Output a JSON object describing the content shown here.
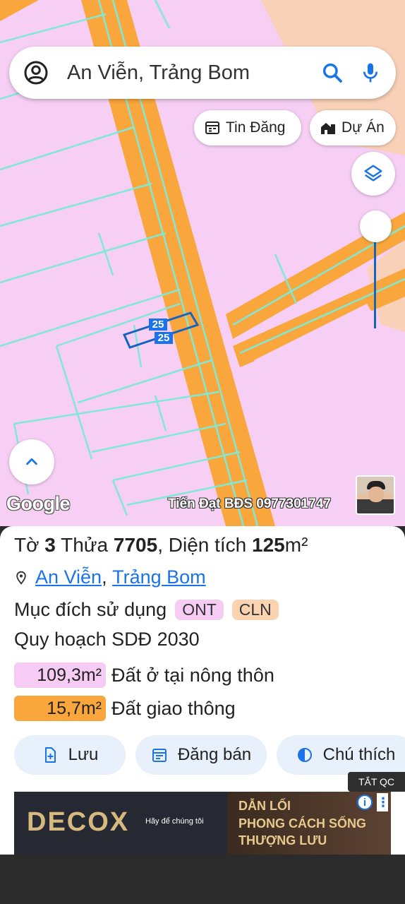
{
  "search": {
    "query": "An Viễn, Trảng Bom"
  },
  "chips": {
    "listings": "Tin Đăng",
    "projects": "Dự Án"
  },
  "map": {
    "parcel_label_1": "25",
    "parcel_label_2": "25",
    "google_logo": "Google",
    "watermark": "Tiến Đạt BĐS 0977301747"
  },
  "parcel": {
    "sheet_label": "Tờ",
    "sheet": "3",
    "lot_label": "Thửa",
    "lot": "7705",
    "area_label": ", Diện tích",
    "area": "125",
    "area_unit": "m²",
    "commune": "An Viễn",
    "district": "Trảng Bom",
    "purpose_label": "Mục đích sử dụng",
    "purpose_tags": [
      "ONT",
      "CLN"
    ],
    "plan_label": "Quy hoạch SDĐ 2030",
    "plan_rows": [
      {
        "value": "109,3m²",
        "label": "Đất ở tại nông thôn",
        "color": "#f6ccf4"
      },
      {
        "value": "15,7m²",
        "label": "Đất giao thông",
        "color": "#f9a73c"
      }
    ]
  },
  "actions": {
    "save": "Lưu",
    "post": "Đăng bán",
    "legend": "Chú thích"
  },
  "ad": {
    "close_label": "TẮT QC",
    "brand": "DECOX",
    "tagline": "Hãy để chúng tôi",
    "line1": "DẪN LỐI",
    "line2": "PHONG CÁCH SỐNG",
    "line3": "THƯỢNG LƯU"
  },
  "colors": {
    "residential": "#f7cff5",
    "road": "#f9a73c",
    "parcel_line": "#7fe8d6",
    "accent": "#1a73e8",
    "panel_button": "#e8f0fb"
  }
}
